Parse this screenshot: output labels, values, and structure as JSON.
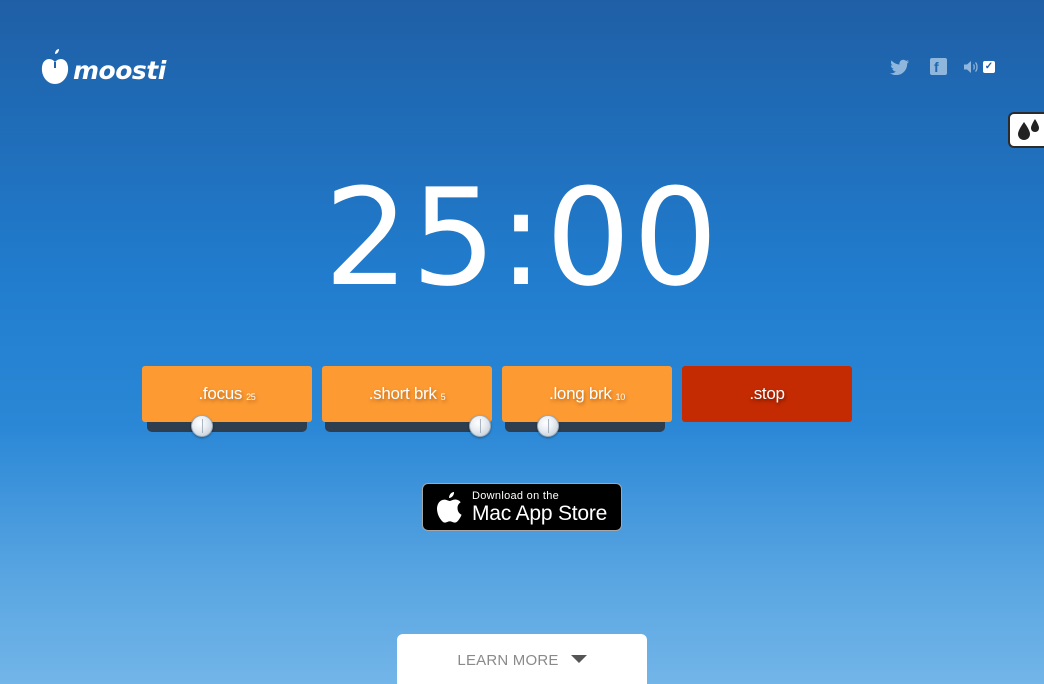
{
  "brand": {
    "name": "moosti"
  },
  "header": {
    "icons": [
      "twitter-icon",
      "facebook-icon",
      "sound-icon"
    ],
    "sound_enabled": true
  },
  "timer": {
    "display": "25:00"
  },
  "modes": [
    {
      "label": ".focus",
      "minutes": "25",
      "slider_level": 0.25
    },
    {
      "label": ".short brk",
      "minutes": "5",
      "slider_level": 1.0
    },
    {
      "label": ".long brk",
      "minutes": "10",
      "slider_level": 0.17
    }
  ],
  "stop": {
    "label": ".stop"
  },
  "colors": {
    "mode_button": "#fd9a32",
    "stop_button": "#c42b02",
    "slider_track": "#2c3e50"
  },
  "appstore": {
    "small": "Download on the",
    "big": "Mac App Store"
  },
  "learn_more": {
    "label": "LEARN MORE"
  }
}
